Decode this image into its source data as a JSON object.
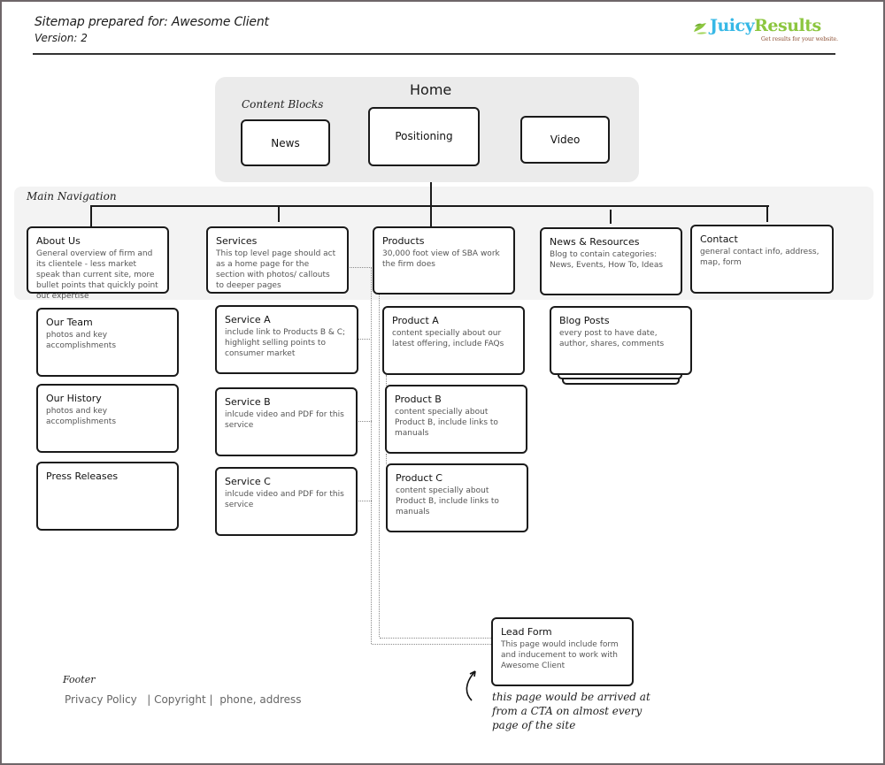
{
  "header": {
    "title": "Sitemap prepared for:  Awesome Client",
    "version": "Version: 2"
  },
  "logo": {
    "juicy": "Juicy",
    "results": "Results",
    "tagline": "Get results for your website.",
    "colors": {
      "juicy": "#37b8e6",
      "results": "#8cc63f",
      "leaf": "#8cc63f",
      "tagline": "#8a4b2e"
    }
  },
  "home": {
    "title": "Home",
    "section_label": "Content Blocks",
    "blocks": [
      {
        "title": "News"
      },
      {
        "title": "Positioning"
      },
      {
        "title": "Video"
      }
    ]
  },
  "main_navigation": {
    "section_label": "Main Navigation",
    "items": [
      {
        "title": "About Us",
        "desc": "General overview of firm and its clientele - less market speak than current site, more bullet points that quickly point out expertise"
      },
      {
        "title": "Services",
        "desc": "This top level page should act as a home page for the section with photos/ callouts to deeper pages"
      },
      {
        "title": "Products",
        "desc": "30,000 foot view of SBA work the firm does"
      },
      {
        "title": "News & Resources",
        "desc": "Blog to contain categories: News, Events, How To, Ideas"
      },
      {
        "title": "Contact",
        "desc": "general contact info, address, map, form"
      }
    ]
  },
  "about_children": [
    {
      "title": "Our Team",
      "desc": "photos and key accomplishments"
    },
    {
      "title": "Our History",
      "desc": "photos and key accomplishments"
    },
    {
      "title": "Press Releases",
      "desc": ""
    }
  ],
  "services_children": [
    {
      "title": "Service A",
      "desc": "include link to Products B & C; highlight selling points to consumer market"
    },
    {
      "title": "Service B",
      "desc": "inlcude video and PDF for this service"
    },
    {
      "title": "Service C",
      "desc": "inlcude video and PDF for this service"
    }
  ],
  "products_children": [
    {
      "title": "Product A",
      "desc": "content specially about our latest offering, include FAQs"
    },
    {
      "title": "Product B",
      "desc": "content specially about Product B, include links to manuals"
    },
    {
      "title": "Product C",
      "desc": "content specially about Product B, include links to manuals"
    }
  ],
  "news_children": [
    {
      "title": "Blog Posts",
      "desc": "every post to have date, author, shares, comments"
    }
  ],
  "lead_form": {
    "title": "Lead Form",
    "desc": "This page would include form and inducement to work with Awesome Client",
    "note": "this page would be arrived at  from a CTA on almost every page of the site"
  },
  "footer": {
    "label": "Footer",
    "links": "Privacy Policy   | Copyright |  phone, address"
  }
}
